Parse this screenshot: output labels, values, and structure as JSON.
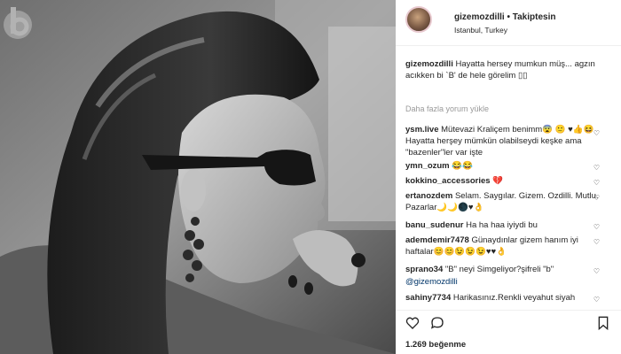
{
  "post": {
    "username": "gizemozdilli",
    "follow_label": "Takiptesin",
    "separator": "•",
    "location": "Istanbul, Turkey"
  },
  "caption": {
    "username": "gizemozdilli",
    "text": "Hayatta hersey mumkun müş... agzın acıkken bi `B' de hele görelim ▯▯"
  },
  "load_more_label": "Daha fazla yorum yükle",
  "comments": [
    {
      "username": "ysm.live",
      "text": "Mütevazi Kraliçem benimm😨 🙂 ♥👍😆Hayatta herşey mümkün olabilseydi keşke ama \"bazenler\"ler var işte"
    },
    {
      "username": "ymn_ozum",
      "text": "😂😂"
    },
    {
      "username": "kokkino_accessories",
      "text": "💔"
    },
    {
      "username": "ertanozdem",
      "text": "Selam. Saygılar. Gizem. Ozdilli. Mutlu. Pazarlar🌙🌙🌑♥👌"
    },
    {
      "username": "banu_sudenur",
      "text": "Ha ha haa iyiydi bu"
    },
    {
      "username": "ademdemir7478",
      "text": "Günaydınlar gizem hanım iyi haftalar😊😊😉😉😉♥♥👌"
    },
    {
      "username": "sprano34",
      "text": "\"B\" neyi Simgeliyor?şifreli \"b\""
    },
    {
      "username": "@gizemozdilli",
      "text": ""
    },
    {
      "username": "sahiny7734",
      "text": "Harikasınız.Renkli veyahut siyah"
    }
  ],
  "likes": {
    "count_label": "1.269 beğenme"
  },
  "icons": {
    "like": "heart-icon",
    "comment": "comment-icon",
    "bookmark": "bookmark-icon",
    "comment_like": "small-heart-icon",
    "watermark": "watermark-logo"
  },
  "colors": {
    "link_blue": "#003569",
    "muted": "#999999",
    "text": "#262626",
    "heart_red": "#ed4956"
  }
}
